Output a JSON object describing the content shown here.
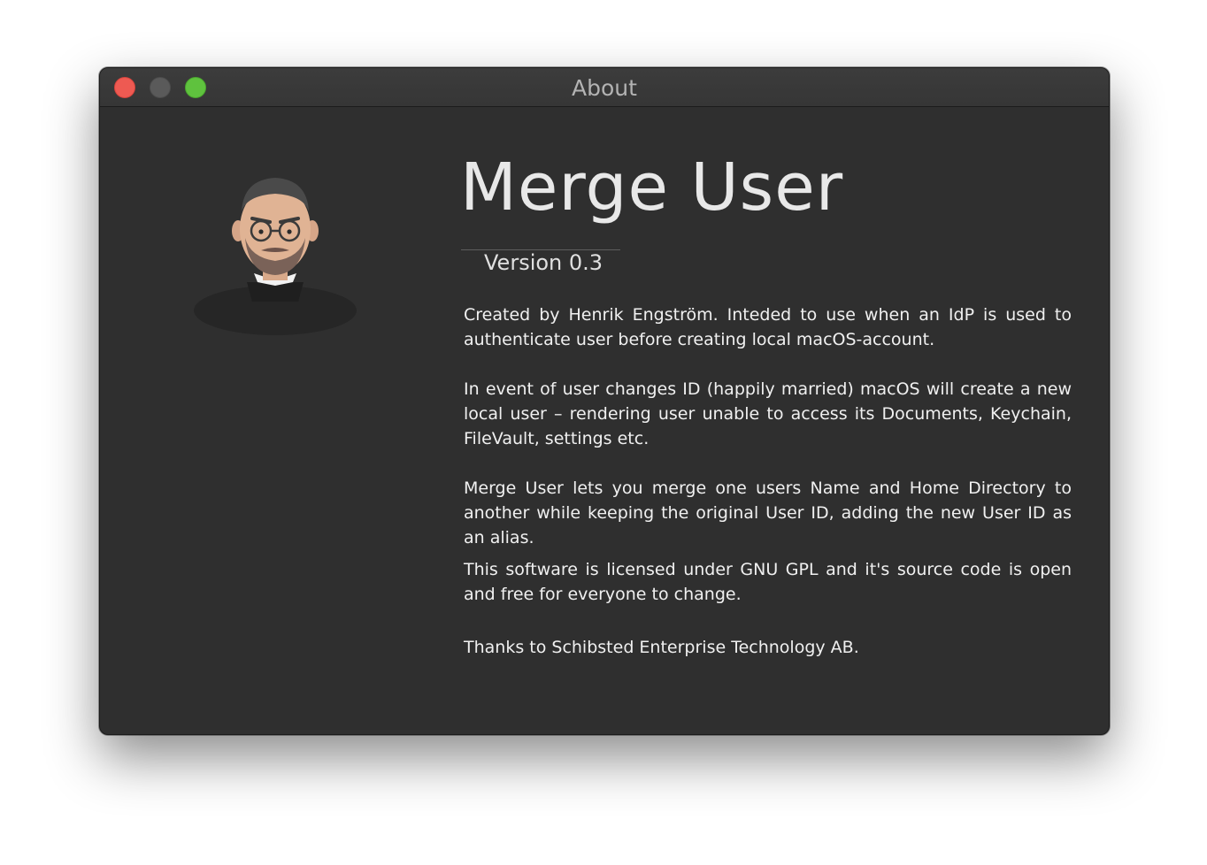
{
  "window": {
    "title": "About"
  },
  "controls": {
    "close": "close-button",
    "minimize": "minimize-button",
    "zoom": "zoom-button"
  },
  "about": {
    "app_name": "Merge User",
    "version": "Version 0.3",
    "avatar_icon": "person-avatar-illustration",
    "paragraphs": [
      "Created by Henrik Engström. Inteded to use when an IdP is used to authenticate user before creating local macOS-account.",
      "In event of user changes ID (happily married) macOS will create a new local user – rendering user unable to access its Documents, Keychain, FileVault, settings etc.",
      "Merge User lets you merge one users Name and Home Directory to another while keeping the original User ID, adding the new User ID as an alias.",
      "This software is licensed under GNU GPL and it's source code is open and free for everyone to change.",
      "Thanks to Schibsted Enterprise Technology AB."
    ]
  },
  "colors": {
    "window_bg": "#2f2f2f",
    "titlebar_bg": "#3a3a3a",
    "close": "#ee5a52",
    "minimize": "#5a5a5a",
    "zoom": "#5fc23e",
    "text": "#f0f0f0"
  }
}
